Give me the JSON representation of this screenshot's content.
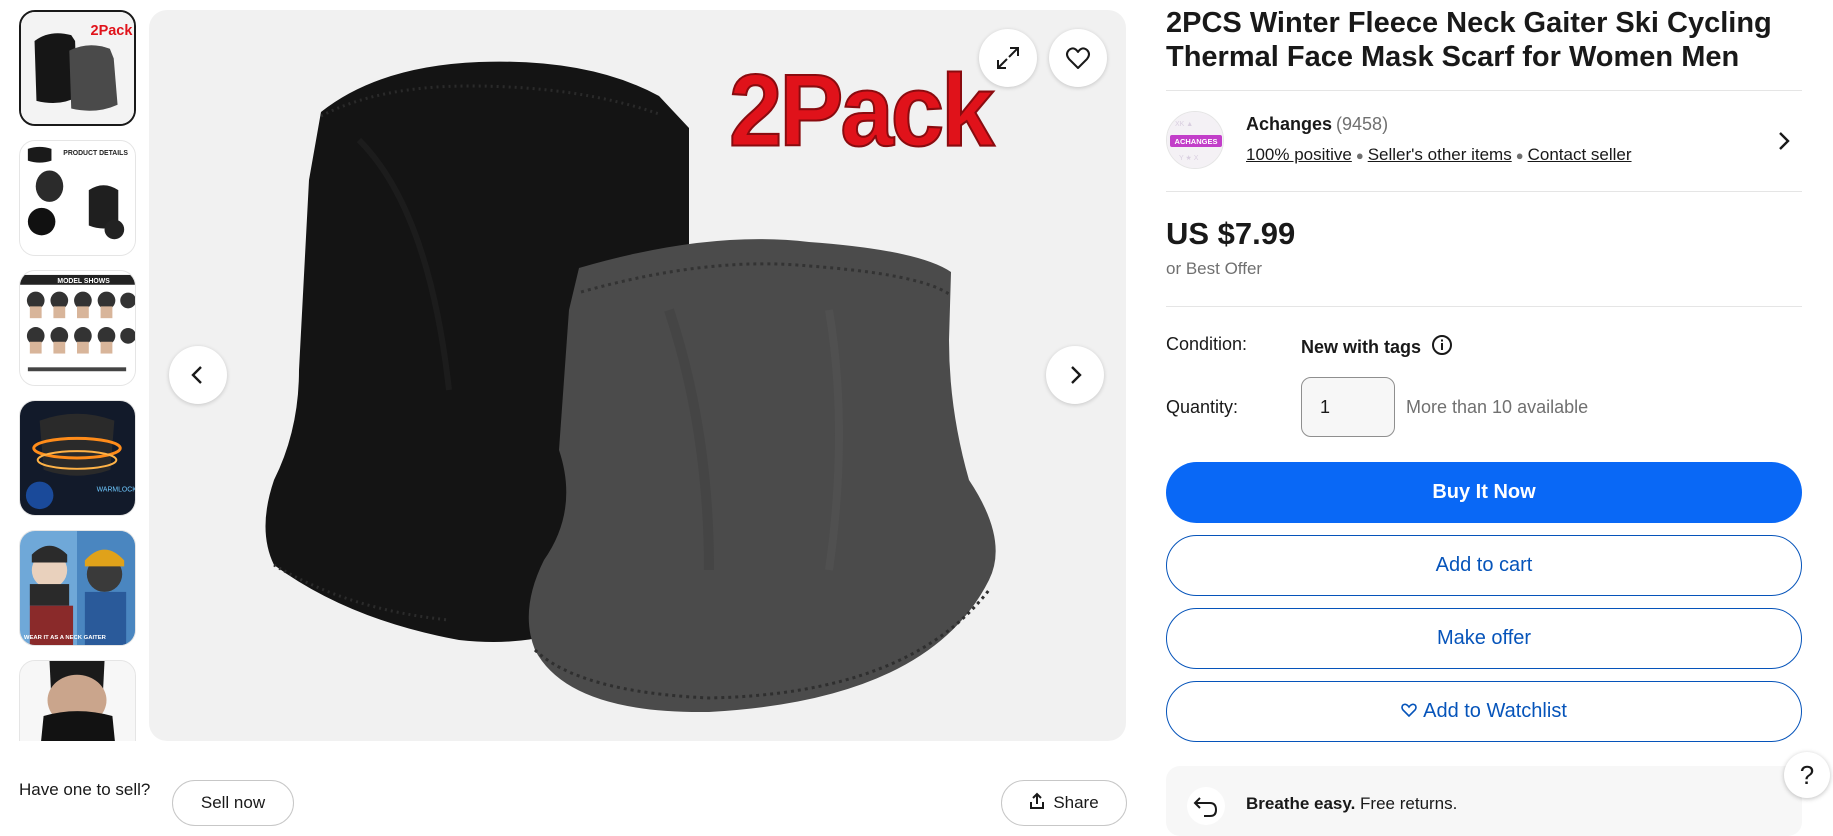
{
  "gallery": {
    "thumbnails": [
      {
        "caption": "2Pack"
      },
      {
        "caption": "PRODUCT DETAILS"
      },
      {
        "caption": "MODEL SHOWS"
      },
      {
        "caption": ""
      },
      {
        "caption": "WEAR IT AS A NECK GAITER"
      },
      {
        "caption": ""
      }
    ],
    "main_overlay_text": "2Pack",
    "expand_icon": "expand-icon",
    "favorite_icon": "heart-icon"
  },
  "below_image": {
    "have_one": "Have one to sell?",
    "sell_now": "Sell now",
    "share": "Share"
  },
  "product": {
    "title": "2PCS Winter Fleece Neck Gaiter Ski Cycling Thermal Face Mask Scarf for Women Men",
    "price": "US $7.99",
    "best_offer": "or Best Offer",
    "condition_label": "Condition:",
    "condition_value": "New with tags",
    "quantity_label": "Quantity:",
    "quantity_value": "1",
    "availability": "More than 10 available"
  },
  "seller": {
    "name": "Achanges",
    "feedback_count": "(9458)",
    "positive": "100% positive",
    "other_items": "Seller's other items",
    "contact": "Contact seller",
    "logo_text": "ACHANGES"
  },
  "actions": {
    "buy_now": "Buy It Now",
    "add_to_cart": "Add to cart",
    "make_offer": "Make offer",
    "add_to_watchlist": "Add to Watchlist"
  },
  "returns": {
    "heading": "Breathe easy.",
    "text": "Free returns."
  },
  "help": "?",
  "colors": {
    "primary": "#0968f6",
    "link_blue": "#0654ba",
    "promo_red": "#e0121a"
  }
}
